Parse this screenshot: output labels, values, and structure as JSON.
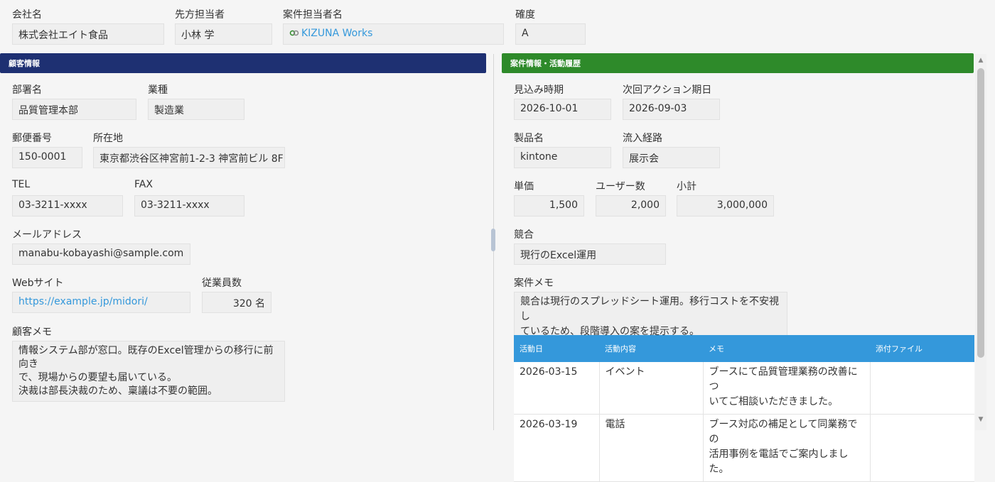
{
  "top": {
    "company": {
      "label": "会社名",
      "value": "株式会社エイト食品"
    },
    "client_contact": {
      "label": "先方担当者",
      "value": "小林 学"
    },
    "deal_owner": {
      "label": "案件担当者名",
      "value": "KIZUNA Works"
    },
    "certainty": {
      "label": "確度",
      "value": "A"
    }
  },
  "customer": {
    "header": "顧客情報",
    "department": {
      "label": "部署名",
      "value": "品質管理本部"
    },
    "industry": {
      "label": "業種",
      "value": "製造業"
    },
    "postal": {
      "label": "郵便番号",
      "value": "150-0001"
    },
    "address": {
      "label": "所在地",
      "value": "東京都渋谷区神宮前1-2-3 神宮前ビル 8F"
    },
    "tel": {
      "label": "TEL",
      "value": "03-3211-xxxx"
    },
    "fax": {
      "label": "FAX",
      "value": "03-3211-xxxx"
    },
    "email": {
      "label": "メールアドレス",
      "value": "manabu-kobayashi@sample.com"
    },
    "website": {
      "label": "Webサイト",
      "value": "https://example.jp/midori/"
    },
    "employees": {
      "label": "従業員数",
      "value": "320",
      "unit": "名"
    },
    "memo": {
      "label": "顧客メモ",
      "lines": [
        "情報システム部が窓口。既存のExcel管理からの移行に前向き",
        "で、現場からの要望も届いている。",
        "決裁は部長決裁のため、稟議は不要の範囲。"
      ]
    }
  },
  "deal": {
    "header": "案件情報・活動履歴",
    "expected": {
      "label": "見込み時期",
      "value": "2026-10-01"
    },
    "next_action": {
      "label": "次回アクション期日",
      "value": "2026-09-03"
    },
    "product": {
      "label": "製品名",
      "value": "kintone"
    },
    "channel": {
      "label": "流入経路",
      "value": "展示会"
    },
    "unit_price": {
      "label": "単価",
      "value": "1,500"
    },
    "users": {
      "label": "ユーザー数",
      "value": "2,000"
    },
    "subtotal": {
      "label": "小計",
      "value": "3,000,000"
    },
    "competitor": {
      "label": "競合",
      "value": "現行のExcel運用"
    },
    "memo": {
      "label": "案件メモ",
      "lines": [
        "競合は現行のスプレッドシート運用。移行コストを不安視し",
        "ているため、段階導入の案を提示する。"
      ]
    }
  },
  "activity": {
    "columns": [
      "活動日",
      "活動内容",
      "メモ",
      "添付ファイル"
    ],
    "rows": [
      {
        "date": "2026-03-15",
        "type": "イベント",
        "memo": [
          "ブースにて品質管理業務の改善につ",
          "いてご相談いただきました。"
        ],
        "file": ""
      },
      {
        "date": "2026-03-19",
        "type": "電話",
        "memo": [
          "ブース対応の補足として同業務での",
          "活用事例を電話でご案内しました。"
        ],
        "file": ""
      }
    ]
  },
  "icons": {
    "user_icon": "link-chain-icon",
    "scroll_up": "triangle-up-icon",
    "scroll_down": "triangle-down-icon"
  },
  "colors": {
    "customer_header": "#1e3072",
    "deal_header": "#2e8a2a",
    "table_header": "#3498db",
    "link": "#3498db"
  }
}
